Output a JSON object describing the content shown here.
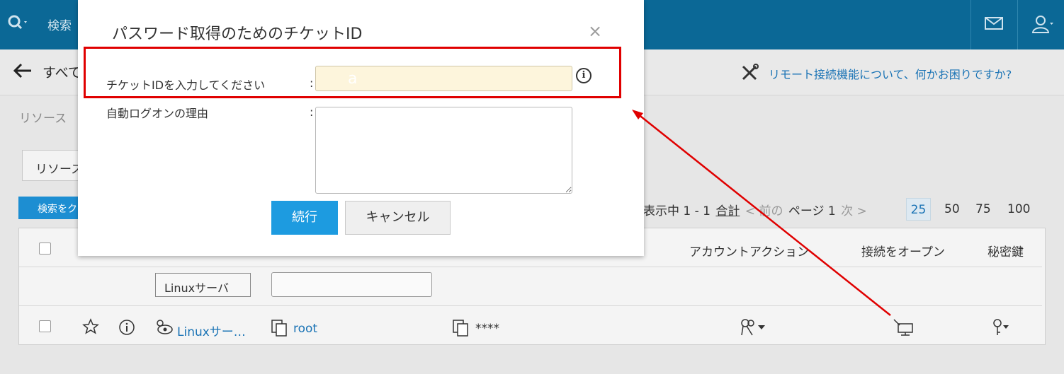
{
  "topbar": {
    "search_label": "検索",
    "search_icon": "search-icon",
    "mail_icon": "mail-icon",
    "user_icon": "user-icon"
  },
  "subbar": {
    "breadcrumb": "すべて",
    "help_link": "リモート接続機能について、何かお困りですか?"
  },
  "page": {
    "resource_crumb": "リソース",
    "resource_button": "リソース",
    "search_button": "検索をク"
  },
  "pager": {
    "showing": "表示中 1 - 1",
    "total": "合計",
    "prev": "< 前の",
    "page": "ページ 1",
    "next": "次 >",
    "sizes": [
      "25",
      "50",
      "75",
      "100"
    ]
  },
  "table": {
    "headers": {
      "account_action": "アカウントアクション",
      "open_connection": "接続をオープン",
      "private_key": "秘密鍵"
    },
    "filter_button": "Linuxサーバ",
    "row": {
      "resource": "Linuxサー…",
      "account": "root",
      "password": "****"
    }
  },
  "modal": {
    "title": "パスワード取得のためのチケットID",
    "close": "×",
    "ticket_label": "チケットIDを入力してください",
    "ticket_value": "a",
    "colon": ":",
    "reason_label": "自動ログオンの理由",
    "continue_label": "続行",
    "cancel_label": "キャンセル"
  },
  "colors": {
    "topbar": "#0b6896",
    "primary": "#1d9be0",
    "highlight_box": "#e00000",
    "input_bg": "#fdf5dc"
  }
}
